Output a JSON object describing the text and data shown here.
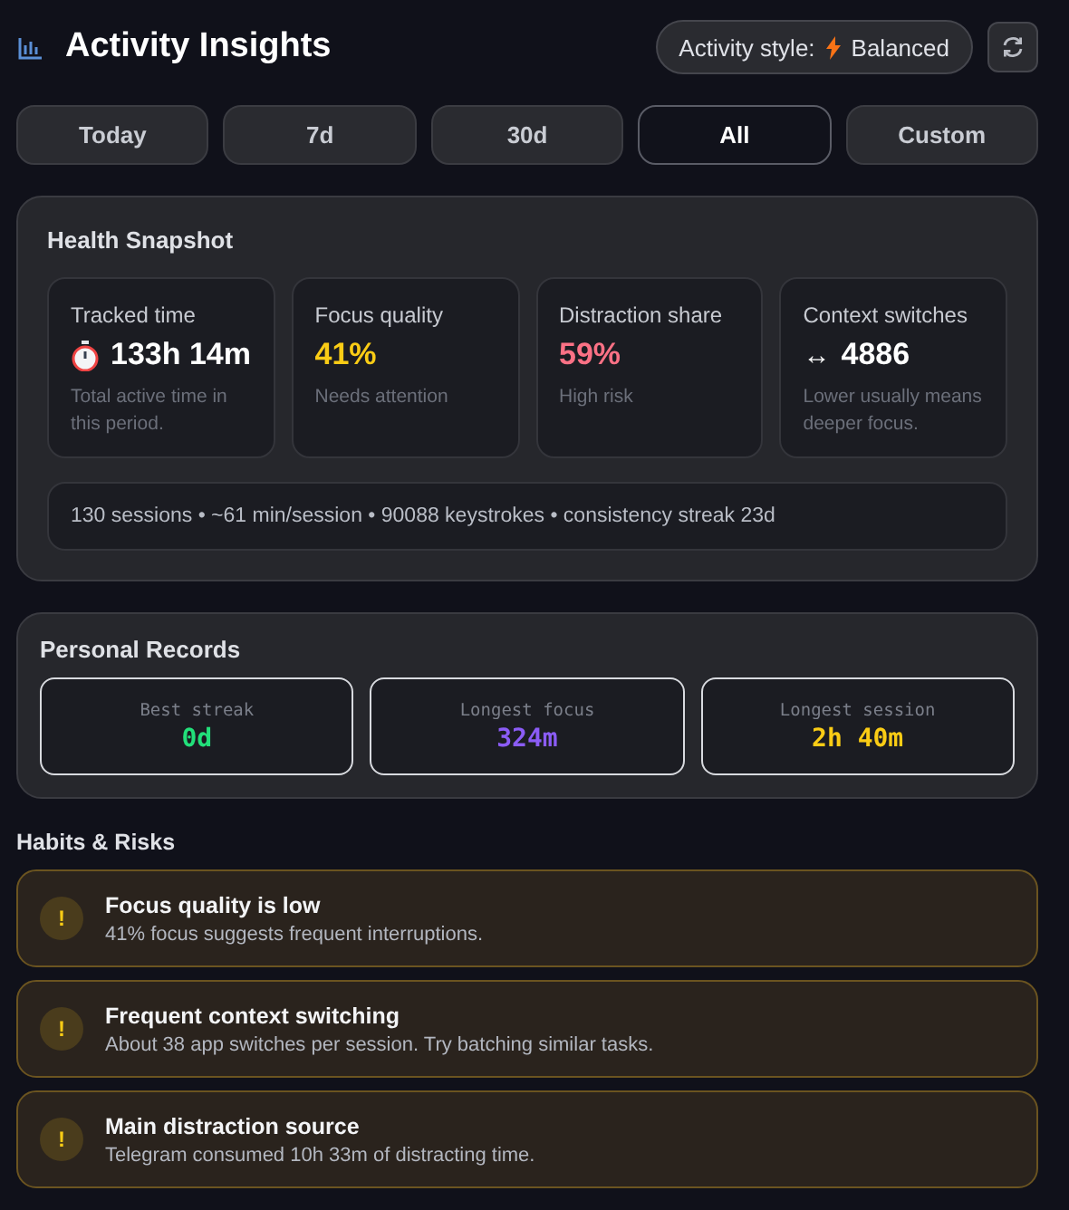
{
  "header": {
    "title": "Activity Insights",
    "style_label": "Activity style:",
    "style_value": "Balanced"
  },
  "tabs": [
    {
      "label": "Today",
      "selected": false
    },
    {
      "label": "7d",
      "selected": false
    },
    {
      "label": "30d",
      "selected": false
    },
    {
      "label": "All",
      "selected": true
    },
    {
      "label": "Custom",
      "selected": false
    }
  ],
  "health": {
    "title": "Health Snapshot",
    "metrics": [
      {
        "kind": "timer",
        "label": "Tracked time",
        "value": "133h 14m",
        "color": "#ffffff",
        "note": "Total active time in this period."
      },
      {
        "kind": "plain",
        "label": "Focus quality",
        "value": "41%",
        "color": "#facc15",
        "note": "Needs attention"
      },
      {
        "kind": "plain",
        "label": "Distraction share",
        "value": "59%",
        "color": "#fb7185",
        "note": "High risk"
      },
      {
        "kind": "symbol",
        "symbol": "↔",
        "label": "Context switches",
        "value": "4886",
        "color": "#ffffff",
        "note": "Lower usually means deeper focus."
      }
    ],
    "summary": "130 sessions • ~61 min/session • 90088 keystrokes • consistency streak 23d"
  },
  "records": {
    "title": "Personal Records",
    "items": [
      {
        "label": "Best streak",
        "value": "0d",
        "color": "#22e07a"
      },
      {
        "label": "Longest focus",
        "value": "324m",
        "color": "#8b5cf6"
      },
      {
        "label": "Longest session",
        "value": "2h 40m",
        "color": "#facc15"
      }
    ]
  },
  "habits": {
    "title": "Habits & Risks",
    "alerts": [
      {
        "kind": "warning",
        "icon": "!",
        "title": "Focus quality is low",
        "text": "41% focus suggests frequent interruptions."
      },
      {
        "kind": "warning",
        "icon": "!",
        "title": "Frequent context switching",
        "text": "About 38 app switches per session. Try batching similar tasks."
      },
      {
        "kind": "warning",
        "icon": "!",
        "title": "Main distraction source",
        "text": "Telegram consumed 10h 33m of distracting time."
      }
    ]
  }
}
